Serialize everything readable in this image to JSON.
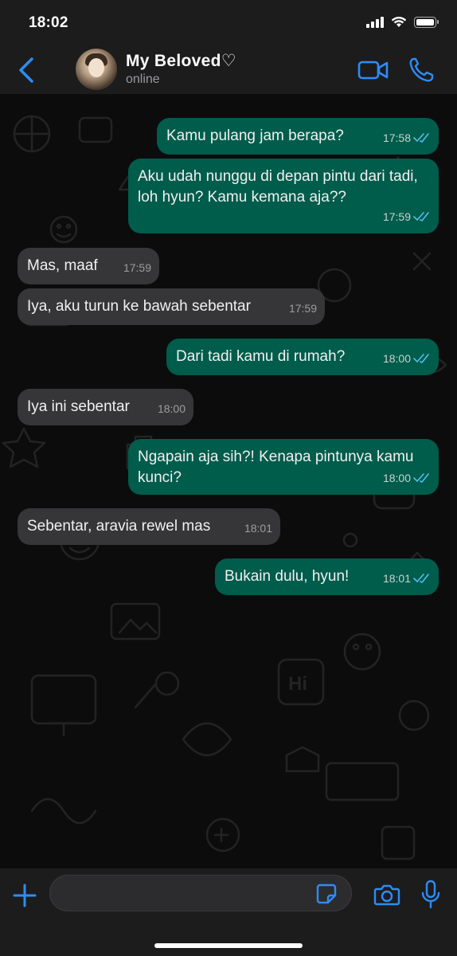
{
  "status_bar": {
    "time": "18:02"
  },
  "header": {
    "name": "My Beloved♡",
    "status": "online"
  },
  "messages": [
    {
      "direction": "out",
      "text": "Kamu pulang jam berapa?",
      "time": "17:58",
      "read": true
    },
    {
      "direction": "out",
      "text": "Aku udah nunggu di depan pintu dari tadi, loh hyun? Kamu kemana aja??",
      "time": "17:59",
      "read": true
    },
    {
      "direction": "in",
      "text": "Mas, maaf",
      "time": "17:59"
    },
    {
      "direction": "in",
      "text": "Iya, aku turun ke bawah sebentar",
      "time": "17:59"
    },
    {
      "direction": "out",
      "text": "Dari tadi kamu di rumah?",
      "time": "18:00",
      "read": true
    },
    {
      "direction": "in",
      "text": "Iya ini sebentar",
      "time": "18:00"
    },
    {
      "direction": "out",
      "text": "Ngapain aja sih?! Kenapa pintunya kamu kunci?",
      "time": "18:00",
      "read": true
    },
    {
      "direction": "in",
      "text": "Sebentar, aravia rewel mas",
      "time": "18:01"
    },
    {
      "direction": "out",
      "text": "Bukain dulu, hyun!",
      "time": "18:01",
      "read": true
    }
  ],
  "composer": {
    "value": "",
    "placeholder": ""
  },
  "colors": {
    "accent": "#2e8cf5",
    "outgoing_bubble": "#005c4b",
    "incoming_bubble": "#363638",
    "read_tick": "#53bdeb"
  },
  "icons": [
    "back-icon",
    "video-icon",
    "call-icon",
    "plus-icon",
    "sticker-icon",
    "camera-icon",
    "mic-icon"
  ]
}
